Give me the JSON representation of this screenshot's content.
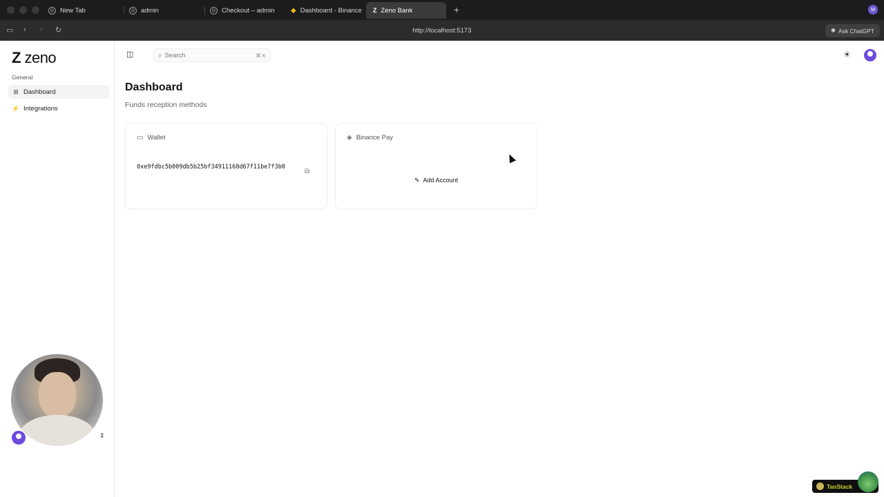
{
  "browser": {
    "tabs": [
      {
        "label": "New Tab",
        "icon": "compass-icon"
      },
      {
        "label": "admin",
        "icon": "compass-icon"
      },
      {
        "label": "Checkout – admin",
        "icon": "compass-icon"
      },
      {
        "label": "Dashboard - Binance",
        "icon": "binance-icon"
      },
      {
        "label": "Zeno Bank",
        "icon": "zeno-icon"
      }
    ],
    "active_tab": 4,
    "profile_initial": "M",
    "url": "http://localhost:5173",
    "ask_chatgpt": "Ask ChatGPT"
  },
  "sidebar": {
    "logo_text": "zeno",
    "group_label": "General",
    "items": [
      {
        "label": "Dashboard",
        "icon": "grid-icon",
        "active": true
      },
      {
        "label": "Integrations",
        "icon": "plug-icon",
        "active": false
      }
    ]
  },
  "header": {
    "search_placeholder": "Search",
    "search_shortcut": "⌘ K"
  },
  "main": {
    "title": "Dashboard",
    "subtitle": "Funds reception methods",
    "cards": [
      {
        "title": "Wallet",
        "icon": "card-icon",
        "address": "0xe9fdbc5b009db5b25bf34911168d67f11be7f3b0"
      },
      {
        "title": "Binance Pay",
        "icon": "layers-icon",
        "button_label": "Add Account"
      }
    ]
  },
  "devtools": {
    "label": "TanStack"
  },
  "colors": {
    "accent": "#6d4ae0",
    "chrome_dark": "#1c1c1e"
  }
}
